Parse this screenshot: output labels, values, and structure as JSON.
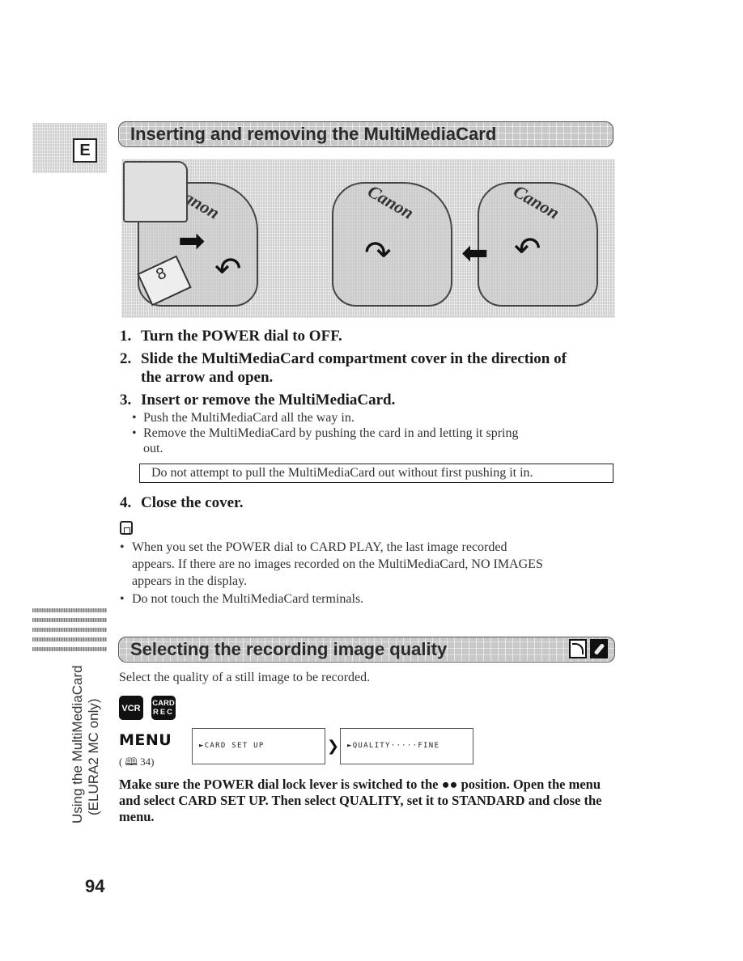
{
  "language_tab": {
    "letter": "E"
  },
  "section1": {
    "title": "Inserting and removing the MultiMediaCard",
    "illustration": {
      "panels": [
        {
          "logo": "Canon",
          "arrows": [
            "insert-arrow",
            "cover-open-arrow"
          ],
          "card_label": "8"
        },
        {
          "logo": "Canon",
          "arrows": [
            "cover-close-arrow"
          ]
        },
        {
          "logo": "Canon",
          "arrows": [
            "eject-arrow",
            "cover-open-arrow"
          ]
        }
      ]
    },
    "steps": [
      {
        "num": "1.",
        "text": "Turn the POWER dial to OFF."
      },
      {
        "num": "2.",
        "text": "Slide the MultiMediaCard compartment cover in the direction of",
        "text2": "the arrow and open."
      },
      {
        "num": "3.",
        "text": "Insert or remove the MultiMediaCard."
      },
      {
        "num": "4.",
        "text": "Close the cover."
      }
    ],
    "step3_bullets": [
      "Push the MultiMediaCard all the way in.",
      "Remove the MultiMediaCard by pushing the card in and letting it spring",
      "out."
    ],
    "caution": "Do not attempt to pull the MultiMediaCard out without first pushing it in.",
    "notes_icon": "memo-icon",
    "notes": [
      "When you set the POWER dial to CARD PLAY, the last image recorded",
      "appears. If there are no images recorded on the MultiMediaCard, NO IMAGES",
      "appears in the display.",
      "Do not touch the MultiMediaCard terminals."
    ]
  },
  "section2": {
    "title": "Selecting the recording image quality",
    "icons": [
      "camera-mode-icon",
      "card-mode-icon"
    ],
    "intro": "Select the quality of a still image to be recorded.",
    "modes": {
      "vcr": "VCR",
      "card_rec_line1": "CARD",
      "card_rec_line2": "REC"
    },
    "menu": {
      "label": "MENU",
      "ref": "( 🕮 34)",
      "box1": "►CARD SET UP",
      "box2": "►QUALITY·····FINE"
    },
    "instruction": "Make sure the POWER dial lock lever is switched to the ●● position. Open the menu and select CARD SET UP. Then select QUALITY, set it to STANDARD and close the menu."
  },
  "sidebar": {
    "line1": "Using the MultiMediaCard",
    "line2": "(ELURA2 MC only)"
  },
  "page_number": "94",
  "bullet_char": "•"
}
